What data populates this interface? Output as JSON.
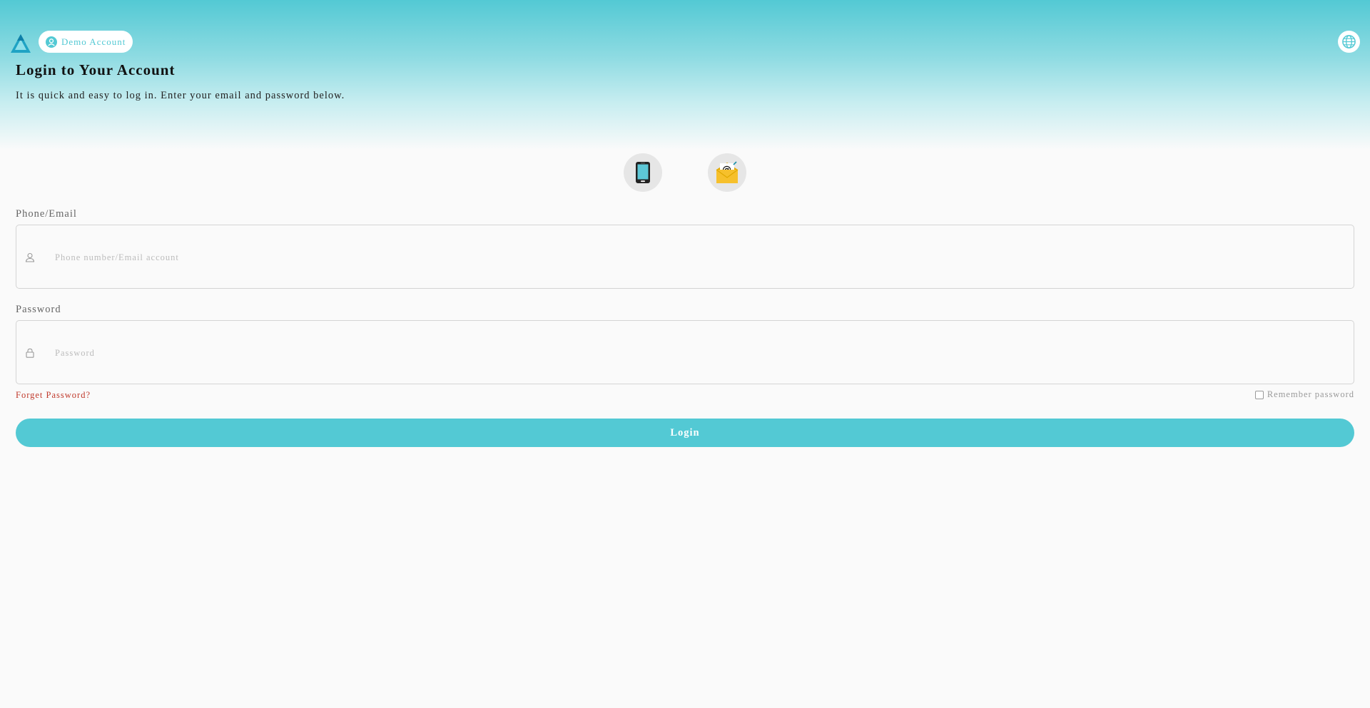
{
  "header": {
    "logo_icon": "triangle-logo-icon",
    "demo_account_label": "Demo Account",
    "language_icon": "globe-icon"
  },
  "main": {
    "title": "Login to Your Account",
    "subtitle": "It is quick and easy to log in. Enter your email and password below.",
    "login_methods": [
      {
        "icon": "mobile-phone-icon",
        "method": "phone"
      },
      {
        "icon": "email-envelope-icon",
        "method": "email"
      }
    ]
  },
  "form": {
    "account_label": "Phone/Email",
    "account_placeholder": "Phone number/Email account",
    "account_value": "",
    "password_label": "Password",
    "password_placeholder": "Password",
    "password_value": "",
    "forget_password": "Forget Password?",
    "remember_label": "Remember password",
    "remember_checked": false,
    "login_label": "Login"
  },
  "colors": {
    "accent": "#53c9d4",
    "link_danger": "#c0392b",
    "background": "#fafafa"
  }
}
